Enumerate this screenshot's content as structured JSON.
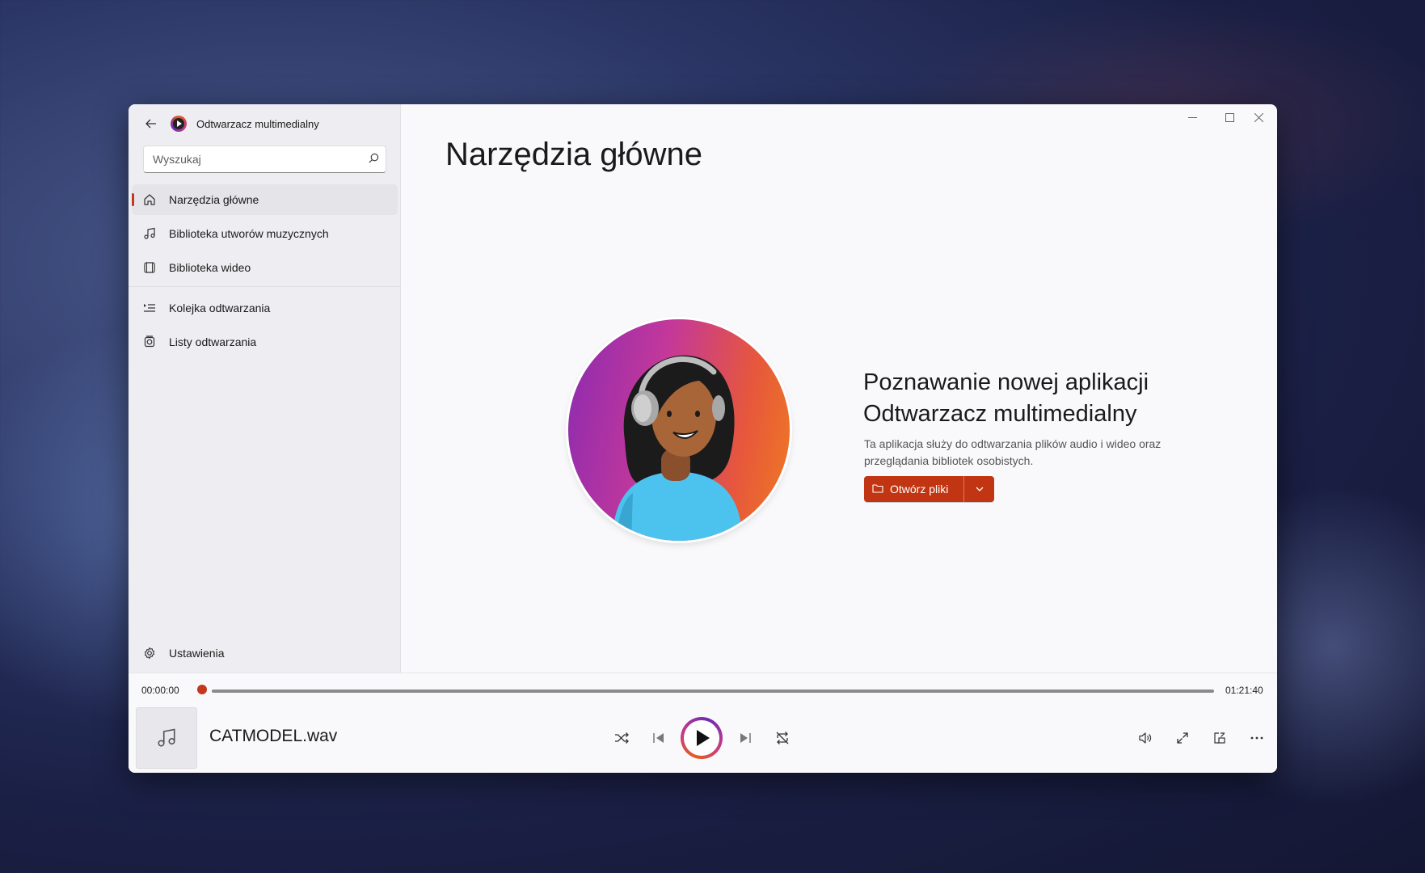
{
  "app": {
    "title": "Odtwarzacz multimedialny"
  },
  "search": {
    "placeholder": "Wyszukaj"
  },
  "sidebar": {
    "items": [
      {
        "label": "Narzędzia główne"
      },
      {
        "label": "Biblioteka utworów muzycznych"
      },
      {
        "label": "Biblioteka wideo"
      },
      {
        "label": "Kolejka odtwarzania"
      },
      {
        "label": "Listy odtwarzania"
      }
    ],
    "settings_label": "Ustawienia"
  },
  "main": {
    "page_title": "Narzędzia główne",
    "hero_heading_line1": "Poznawanie nowej aplikacji",
    "hero_heading_line2": "Odtwarzacz multimedialny",
    "hero_description": "Ta aplikacja służy do odtwarzania plików audio i wideo oraz przeglądania bibliotek osobistych.",
    "open_files_label": "Otwórz pliki"
  },
  "player": {
    "current_time": "00:00:00",
    "total_time": "01:21:40",
    "track_name": "CATMODEL.wav",
    "progress": 0
  },
  "colors": {
    "accent": "#c13512",
    "indicator": "#c4391d"
  },
  "icons": {
    "back": "back-arrow-icon",
    "search": "search-icon",
    "home": "home-icon",
    "music": "music-note-icon",
    "video": "film-icon",
    "queue": "queue-icon",
    "playlist": "playlist-icon",
    "settings": "gear-icon",
    "shuffle": "shuffle-icon",
    "previous": "previous-icon",
    "play": "play-icon",
    "next": "next-icon",
    "repeat": "repeat-icon",
    "volume": "volume-icon",
    "fullscreen": "fullscreen-icon",
    "miniplayer": "miniplayer-icon",
    "more": "more-icon"
  }
}
